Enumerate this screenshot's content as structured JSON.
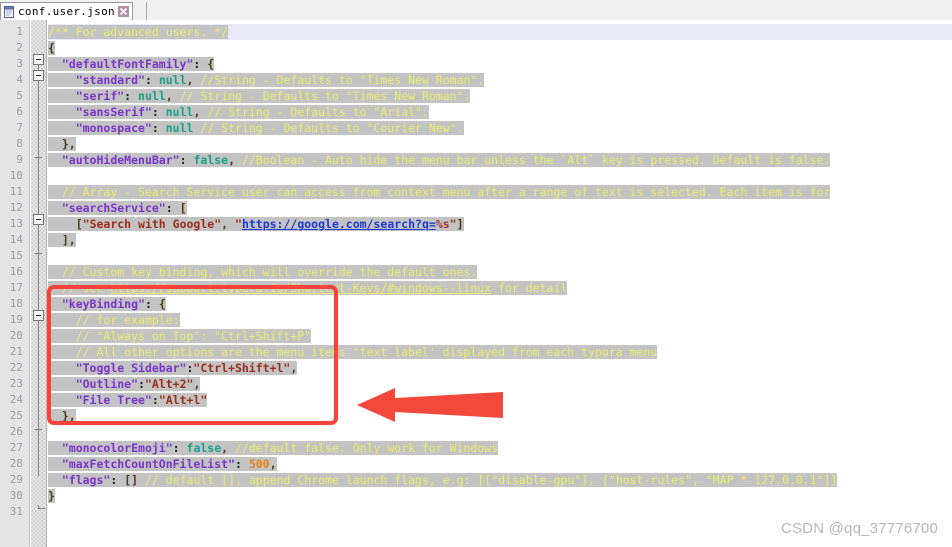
{
  "tab": {
    "filename": "conf.user.json",
    "file_icon": "json-file-icon",
    "close_icon": "close-icon"
  },
  "editor": {
    "current_line": 1,
    "total_lines": 31,
    "line_numbers": [
      1,
      2,
      3,
      4,
      5,
      6,
      7,
      8,
      9,
      10,
      11,
      12,
      13,
      14,
      15,
      16,
      17,
      18,
      19,
      20,
      21,
      22,
      23,
      24,
      25,
      26,
      27,
      28,
      29,
      30,
      31
    ],
    "lines": [
      {
        "n": 1,
        "text": "/** For advanced users. */"
      },
      {
        "n": 2,
        "text": "{"
      },
      {
        "n": 3,
        "text": "  \"defaultFontFamily\": {"
      },
      {
        "n": 4,
        "text": "    \"standard\": null, //String - Defaults to \"Times New Roman\"."
      },
      {
        "n": 5,
        "text": "    \"serif\": null, // String - Defaults to \"Times New Roman\"."
      },
      {
        "n": 6,
        "text": "    \"sansSerif\": null, // String - Defaults to \"Arial\"."
      },
      {
        "n": 7,
        "text": "    \"monospace\": null // String - Defaults to \"Courier New\"."
      },
      {
        "n": 8,
        "text": "  },"
      },
      {
        "n": 9,
        "text": "  \"autoHideMenuBar\": false, //Boolean - Auto hide the menu bar unless the `Alt` key is pressed. Default is false."
      },
      {
        "n": 10,
        "text": ""
      },
      {
        "n": 11,
        "text": "  // Array - Search Service user can access from context menu after a range of text is selected. Each item is for"
      },
      {
        "n": 12,
        "text": "  \"searchService\": ["
      },
      {
        "n": 13,
        "text": "    [\"Search with Google\", \"https://google.com/search?q=%s\"]"
      },
      {
        "n": 14,
        "text": "  ],"
      },
      {
        "n": 15,
        "text": ""
      },
      {
        "n": 16,
        "text": "  // Custom key binding, which will override the default ones."
      },
      {
        "n": 17,
        "text": "  // see https://support.typora.io/Shortcut-Keys/#windows--linux for detail"
      },
      {
        "n": 18,
        "text": "  \"keyBinding\": {"
      },
      {
        "n": 19,
        "text": "    // for example:"
      },
      {
        "n": 20,
        "text": "    // \"Always on Top\": \"Ctrl+Shift+P\""
      },
      {
        "n": 21,
        "text": "    // All other options are the menu items 'text label' displayed from each typora menu"
      },
      {
        "n": 22,
        "text": "    \"Toggle Sidebar\":\"Ctrl+Shift+l\","
      },
      {
        "n": 23,
        "text": "    \"Outline\":\"Alt+2\","
      },
      {
        "n": 24,
        "text": "    \"File Tree\":\"Alt+l\""
      },
      {
        "n": 25,
        "text": "  },"
      },
      {
        "n": 26,
        "text": ""
      },
      {
        "n": 27,
        "text": "  \"monocolorEmoji\": false, //default false. Only work for Windows"
      },
      {
        "n": 28,
        "text": "  \"maxFetchCountOnFileList\": 500,"
      },
      {
        "n": 29,
        "text": "  \"flags\": [] // default [], append Chrome launch flags, e.g: [[\"disable-gpu\"], [\"host-rules\", \"MAP * 127.0.0.1\"]]"
      },
      {
        "n": 30,
        "text": "}"
      },
      {
        "n": 31,
        "text": ""
      }
    ]
  },
  "annotations": {
    "highlight_box_label": "keyBinding block highlight",
    "arrow_label": "pointer arrow to keyBinding block",
    "accent_color": "#f9423a"
  },
  "watermark": {
    "text": "CSDN @qq_37776700"
  }
}
